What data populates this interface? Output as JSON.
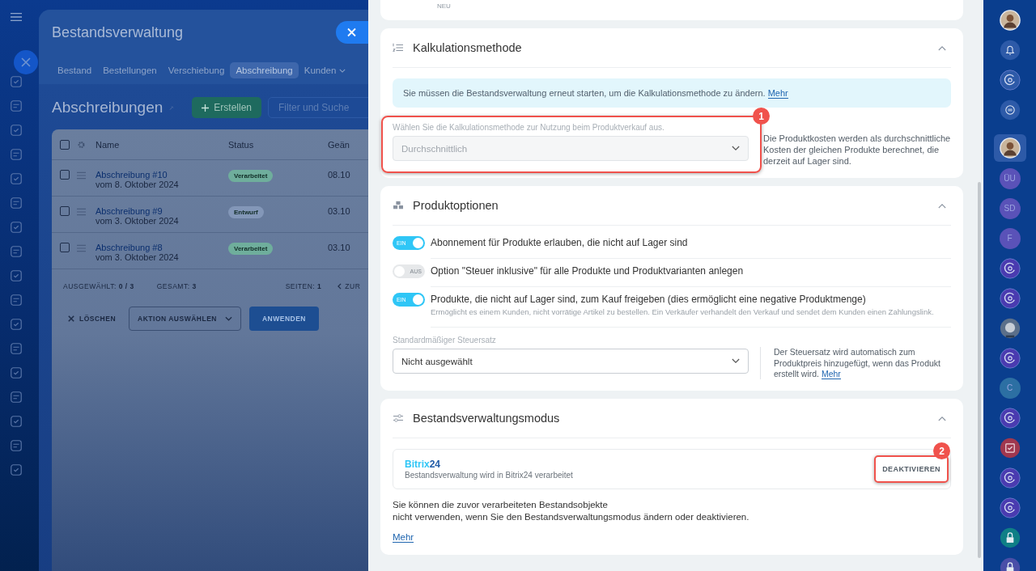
{
  "background_window": {
    "title": "Bestandsverwaltung",
    "tabs": [
      {
        "label": "Bestand",
        "selected": false
      },
      {
        "label": "Bestellungen",
        "selected": false
      },
      {
        "label": "Verschiebung",
        "selected": false
      },
      {
        "label": "Abschreibung",
        "selected": true
      },
      {
        "label": "Kunden",
        "selected": false
      }
    ],
    "page_title": "Abschreibungen",
    "create_button": "Erstellen",
    "search": {
      "placeholder": "Filter und Suche"
    },
    "table": {
      "all_checked": false,
      "columns": [
        "Name",
        "Status",
        "Geän"
      ],
      "rows": [
        {
          "checked": false,
          "name": "Abschreibung #10",
          "date": "vom 8. Oktober 2024",
          "status": "Verarbeitet",
          "color": "#6fae9c",
          "changed": "08.10"
        },
        {
          "checked": false,
          "name": "Abschreibung #9",
          "date": "vom 3. Oktober 2024",
          "status": "Entwurf",
          "color": "#8397b8",
          "changed": "03.10"
        },
        {
          "checked": false,
          "name": "Abschreibung #8",
          "date": "vom 3. Oktober 2024",
          "status": "Verarbeitet",
          "color": "#6fae9c",
          "changed": "03.10"
        }
      ]
    },
    "footer": {
      "selected_label": "AUSGEWÄHLT:",
      "selected": "0 / 3",
      "total_label": "GESAMT:",
      "total": "3",
      "pages_label": "SEITEN:",
      "pages": "1",
      "prev": "ZUR"
    },
    "actions": {
      "delete": "LÖSCHEN",
      "action_select": "AKTION AUSWÄHLEN",
      "apply": "ANWENDEN"
    }
  },
  "top_badge": "NEU",
  "sections": [
    {
      "kind": "calc",
      "title": "Kalkulationsmethode",
      "expanded": true,
      "notice": "Sie müssen die Bestandsverwaltung erneut starten, um die Kalkulationsmethode zu ändern.",
      "notice_link": "Mehr",
      "select_label": "Wählen Sie die Kalkulationsmethode zur Nutzung beim Produktverkauf aus.",
      "select_value": "Durchschnittlich",
      "select_disabled": true,
      "callout": "1",
      "hint": "Die Produktkosten werden als durchschnittliche Kosten der gleichen Produkte berechnet, die derzeit auf Lager sind."
    },
    {
      "kind": "options",
      "title": "Produktoptionen",
      "expanded": true,
      "toggles": [
        {
          "on": true,
          "state_text": "EIN",
          "label": "Abonnement für Produkte erlauben, die nicht auf Lager sind"
        },
        {
          "on": false,
          "state_text": "AUS",
          "label": "Option \"Steuer inklusive\" für alle Produkte und Produktvarianten anlegen"
        },
        {
          "on": true,
          "state_text": "EIN",
          "label": "Produkte, die nicht auf Lager sind, zum Kauf freigeben (dies ermöglicht eine negative Produktmenge)",
          "description": "Ermöglicht es einem Kunden, nicht vorrätige Artikel zu bestellen. Ein Verkäufer verhandelt den Verkauf und sendet dem Kunden einen Zahlungslink."
        }
      ],
      "tax_label": "Standardmäßiger Steuersatz",
      "tax_value": "Nicht ausgewählt",
      "tax_hint": "Der Steuersatz wird automatisch zum Produktpreis hinzugefügt, wenn das Produkt erstellt wird.",
      "tax_link": "Mehr"
    },
    {
      "kind": "mode",
      "title": "Bestandsverwaltungsmodus",
      "expanded": true,
      "provider_logo": {
        "main": "Bitrix",
        "suffix": "24"
      },
      "provider_text": "Bestandsverwaltung wird in Bitrix24 verarbeitet",
      "button": "DEAKTIVIEREN",
      "callout": "2",
      "warning": "Sie können die zuvor verarbeiteten Bestandsobjekte\nnicht verwenden, wenn Sie den Bestandsverwaltungsmodus ändern oder deaktivieren.",
      "link": "Mehr"
    }
  ],
  "rail": [
    {
      "kind": "photo",
      "selected": false
    },
    {
      "kind": "bell"
    },
    {
      "kind": "openline"
    },
    {
      "kind": "chat"
    },
    {
      "kind": "photo",
      "selected": true
    },
    {
      "kind": "initials",
      "text": "ÜU",
      "color": "#5a52b8"
    },
    {
      "kind": "initials",
      "text": "SD",
      "color": "#5a52b8"
    },
    {
      "kind": "initials",
      "text": "F",
      "color": "#5a52b8"
    },
    {
      "kind": "openline",
      "color": "#4a3bb0"
    },
    {
      "kind": "openline",
      "color": "#4a3bb0"
    },
    {
      "kind": "cat"
    },
    {
      "kind": "openline",
      "color": "#4a3bb0"
    },
    {
      "kind": "initials",
      "text": "C",
      "color": "#2c6fa3"
    },
    {
      "kind": "openline",
      "color": "#4a3bb0"
    },
    {
      "kind": "task",
      "color": "#a0374f"
    },
    {
      "kind": "openline",
      "color": "#4a3bb0"
    },
    {
      "kind": "openline",
      "color": "#4a3bb0"
    },
    {
      "kind": "lock",
      "color": "#0f7f86"
    },
    {
      "kind": "lock",
      "color": "#4a4fa8"
    }
  ]
}
